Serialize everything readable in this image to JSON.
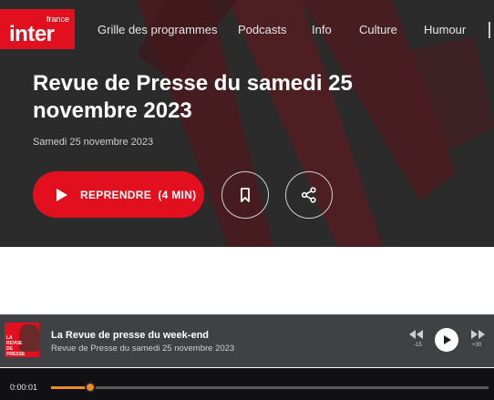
{
  "header": {
    "logo_small": "france",
    "logo_big": "inter",
    "nav": [
      "Grille des programmes",
      "Podcasts",
      "Info",
      "Culture",
      "Humour"
    ]
  },
  "episode": {
    "title": "Revue de Presse du samedi 25 novembre 2023",
    "date": "Samedi 25 novembre 2023",
    "resume_label": "REPRENDRE",
    "remaining": "(4 MIN)"
  },
  "player": {
    "show_title": "La Revue de presse du week-end",
    "episode_title": "Revue de Presse du samedi 25 novembre 2023",
    "thumbnail_text": "LA REVUE DE PRESSE DU WEEK-END",
    "rewind_label": "-15",
    "forward_label": "+30",
    "current_time": "0:00:01",
    "progress_fraction": 0.09
  },
  "colors": {
    "brand_red": "#e20f1e",
    "progress_orange": "#f08a2b",
    "hero_bg": "#2b2b2b",
    "player_bg": "#3f4145"
  },
  "icons": {
    "play": "play-icon",
    "bookmark": "bookmark-icon",
    "share": "share-icon",
    "rewind": "rewind-15-icon",
    "forward": "forward-30-icon"
  }
}
